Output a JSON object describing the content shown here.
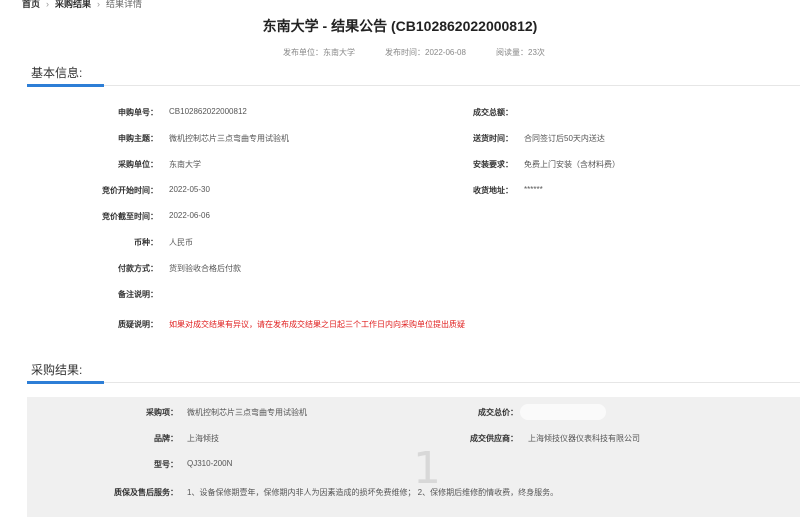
{
  "breadcrumb": {
    "home": "首页",
    "category": "采购结果",
    "current": "结果详情"
  },
  "title": "东南大学 - 结果公告 (CB102862022000812)",
  "meta": {
    "publisher": "发布单位：东南大学",
    "publish_time": "发布时间：2022-06-08",
    "views": "阅读量：23次"
  },
  "basic_info": {
    "heading": "基本信息:",
    "fields": {
      "purchase_no": {
        "label": "申购单号：",
        "value": "CB102862022000812"
      },
      "subject": {
        "label": "申购主题：",
        "value": "微机控制芯片三点弯曲专用试验机"
      },
      "purchaser": {
        "label": "采购单位：",
        "value": "东南大学"
      },
      "bid_start": {
        "label": "竞价开始时间：",
        "value": "2022-05-30"
      },
      "bid_end": {
        "label": "竞价截至时间：",
        "value": "2022-06-06"
      },
      "currency": {
        "label": "币种：",
        "value": "人民币"
      },
      "payment": {
        "label": "付款方式：",
        "value": "货到验收合格后付款"
      },
      "remark": {
        "label": "备注说明：",
        "value": ""
      },
      "objection": {
        "label": "质疑说明：",
        "value": "如果对成交结果有异议，请在发布成交结果之日起三个工作日内向采购单位提出质疑"
      },
      "total": {
        "label": "成交总额：",
        "value": ""
      },
      "delivery_time": {
        "label": "送货时间：",
        "value": "合同签订后50天内送达"
      },
      "install": {
        "label": "安装要求：",
        "value": "免费上门安装（含材料费）"
      },
      "address": {
        "label": "收货地址：",
        "value": "******"
      }
    }
  },
  "result": {
    "heading": "采购结果:",
    "fields": {
      "item": {
        "label": "采购项：",
        "value": "微机控制芯片三点弯曲专用试验机"
      },
      "brand": {
        "label": "品牌：",
        "value": "上海倾技"
      },
      "model": {
        "label": "型号：",
        "value": "QJ310-200N"
      },
      "warranty": {
        "label": "质保及售后服务：",
        "value": "1、设备保修期壹年，保修期内非人为因素造成的损坏免费维修；  2、保修期后维修酌情收费，终身服务。"
      },
      "total_price": {
        "label": "成交总价：",
        "value": ""
      },
      "supplier": {
        "label": "成交供应商：",
        "value": "上海倾技仪器仪表科技有限公司"
      }
    }
  },
  "page_number": "1",
  "colors": {
    "accent": "#2d7ed6",
    "alert": "#e02020"
  }
}
